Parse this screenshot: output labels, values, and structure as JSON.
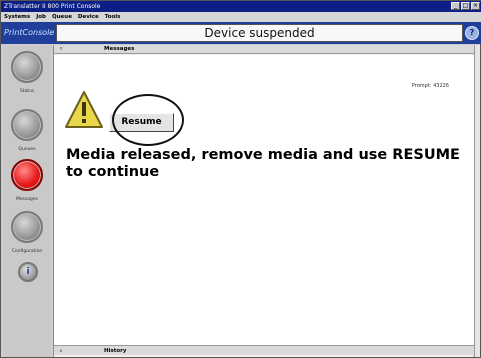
{
  "window": {
    "title": "ZTranslatter II 800 Print Console",
    "controls": [
      "_",
      "□",
      "×"
    ]
  },
  "menu": [
    "Systems",
    "Job",
    "Queue",
    "Device",
    "Tools"
  ],
  "header": {
    "brand": "PrintConsole",
    "title": "Device suspended",
    "help_icon": "help-icon"
  },
  "sidebar": {
    "items": [
      {
        "label": "Status",
        "active": false
      },
      {
        "label": "Queues",
        "active": false
      },
      {
        "label": "Messages",
        "active": true
      },
      {
        "label": "Configuration",
        "active": false
      }
    ],
    "info_icon": "i"
  },
  "messages_panel": {
    "title": "Messages",
    "chevron": "▿",
    "prompt": "Prompt: 43226",
    "resume_label": "Resume",
    "message": "Media released, remove media and use RESUME to continue",
    "warning_color": "#e8d84a"
  },
  "history_panel": {
    "title": "History",
    "chevron": "▹"
  },
  "colors": {
    "title_bar": "#0c1f86",
    "header_bar": "#1f3f9a",
    "active_nav": "#e81a1a"
  }
}
